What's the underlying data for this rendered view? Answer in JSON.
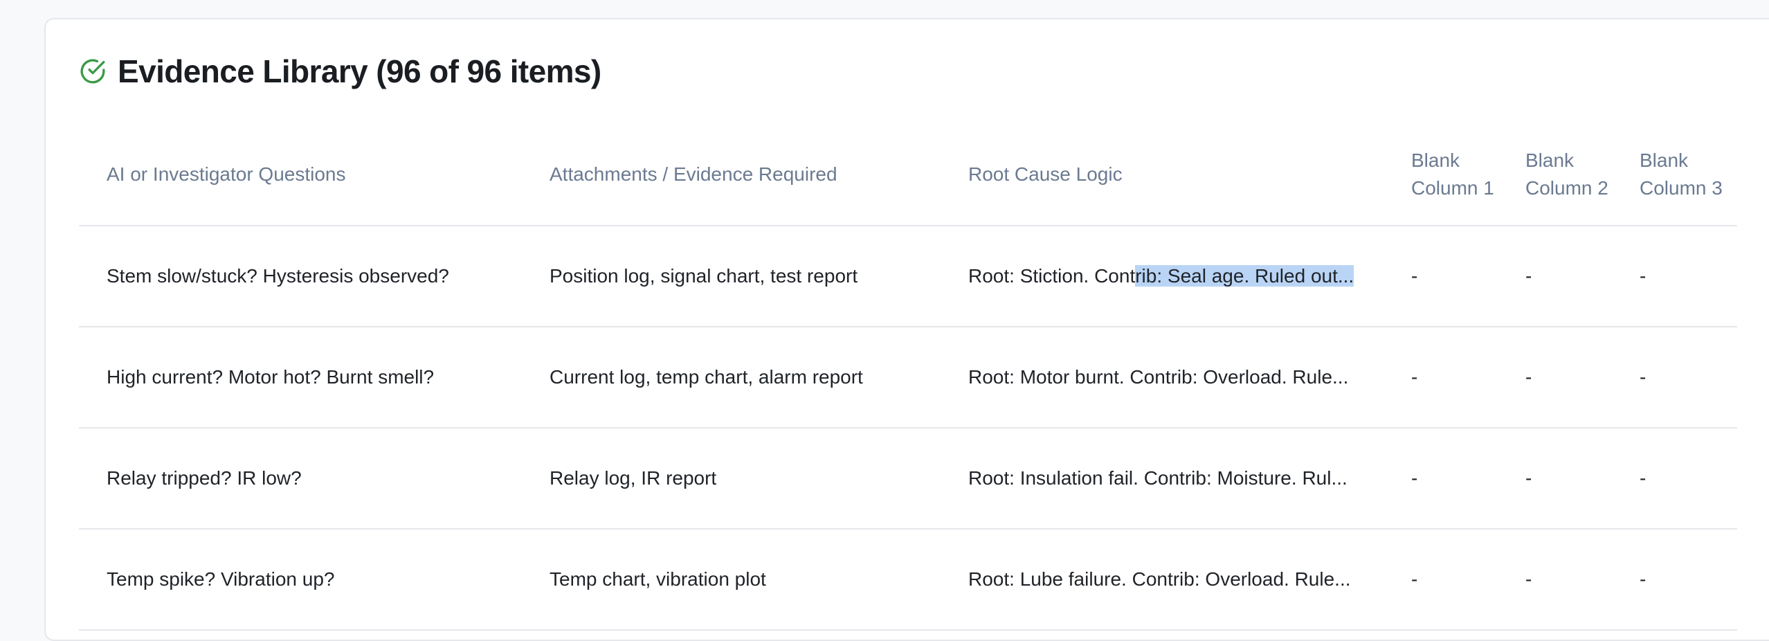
{
  "header": {
    "icon": "check-circle-icon",
    "accent_color": "#3a9a46",
    "title": "Evidence Library (96 of 96 items)"
  },
  "table": {
    "columns": [
      "AI or Investigator Questions",
      "Attachments / Evidence Required",
      "Root Cause Logic",
      "Blank Column 1",
      "Blank Column 2",
      "Blank Column 3"
    ],
    "rows": [
      {
        "questions": "Stem slow/stuck? Hysteresis observed?",
        "evidence": "Position log, signal chart, test report",
        "logic_pre": "Root: Stiction. Cont",
        "logic_sel": "rib: Seal age. Ruled out...",
        "blank1": "-",
        "blank2": "-",
        "blank3": "-"
      },
      {
        "questions": "High current? Motor hot? Burnt smell?",
        "evidence": "Current log, temp chart, alarm report",
        "logic": "Root: Motor burnt. Contrib: Overload. Rule...",
        "blank1": "-",
        "blank2": "-",
        "blank3": "-"
      },
      {
        "questions": "Relay tripped? IR low?",
        "evidence": "Relay log, IR report",
        "logic": "Root: Insulation fail. Contrib: Moisture. Rul...",
        "blank1": "-",
        "blank2": "-",
        "blank3": "-"
      },
      {
        "questions": "Temp spike? Vibration up?",
        "evidence": "Temp chart, vibration plot",
        "logic": "Root: Lube failure. Contrib: Overload. Rule...",
        "blank1": "-",
        "blank2": "-",
        "blank3": "-"
      }
    ]
  }
}
